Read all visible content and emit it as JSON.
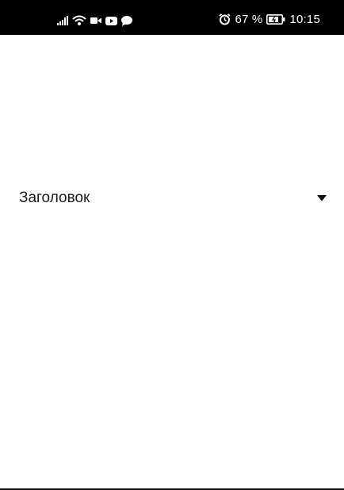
{
  "status_bar": {
    "battery_percent": "67 %",
    "time": "10:15",
    "icons_left": [
      "signal-icon",
      "wifi-icon",
      "video-call-icon",
      "youtube-icon",
      "message-icon"
    ],
    "icons_right": [
      "alarm-icon",
      "battery-charging-icon"
    ]
  },
  "section": {
    "title": "Заголовок",
    "toggle_icon": "caret-down-icon"
  },
  "colors": {
    "status_bar_bg": "#000000",
    "background": "#ffffff",
    "text": "#1a1a1a"
  }
}
